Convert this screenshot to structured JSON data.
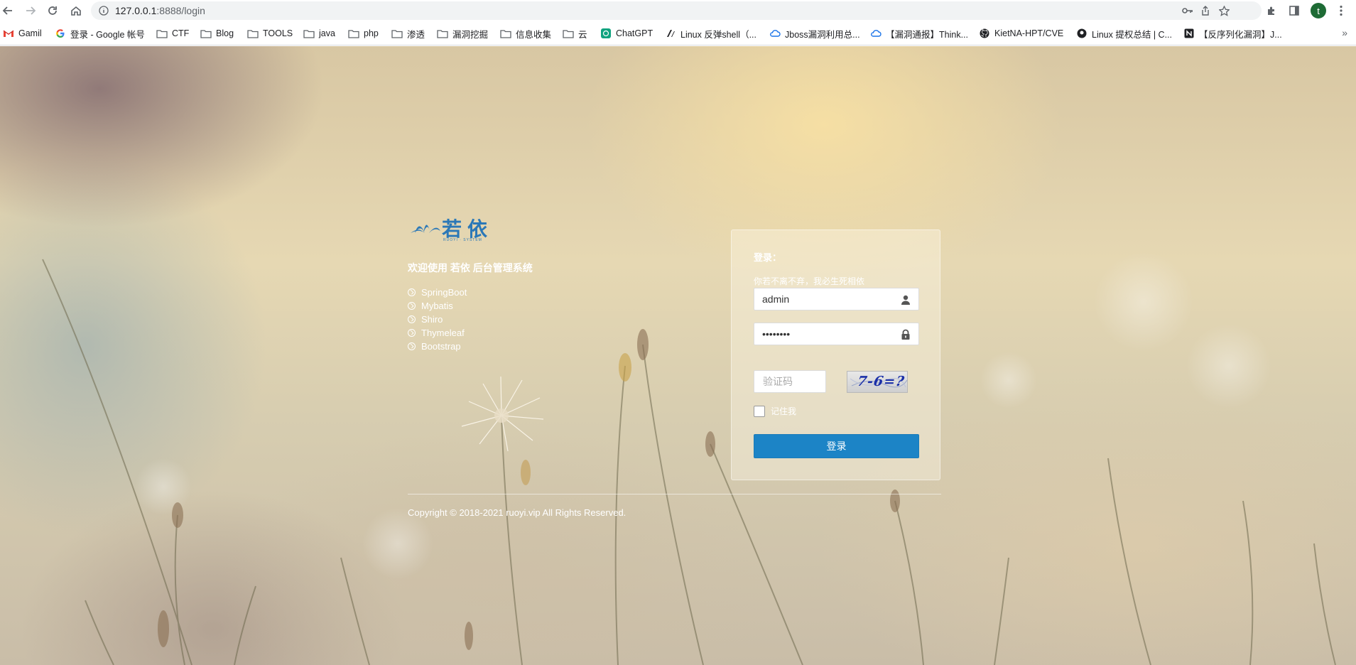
{
  "browser": {
    "url_host": "127.0.0.1",
    "url_path": ":8888/login",
    "profile_initial": "t",
    "bookmarks": [
      {
        "label": "Gamil",
        "icon": "gmail-icon"
      },
      {
        "label": "登录 - Google 帐号",
        "icon": "google-icon"
      },
      {
        "label": "CTF",
        "icon": "folder-icon"
      },
      {
        "label": "Blog",
        "icon": "folder-icon"
      },
      {
        "label": "TOOLS",
        "icon": "folder-icon"
      },
      {
        "label": "java",
        "icon": "folder-icon"
      },
      {
        "label": "php",
        "icon": "folder-icon"
      },
      {
        "label": "渗透",
        "icon": "folder-icon"
      },
      {
        "label": "漏洞挖掘",
        "icon": "folder-icon"
      },
      {
        "label": "信息收集",
        "icon": "folder-icon"
      },
      {
        "label": "云",
        "icon": "folder-icon"
      },
      {
        "label": "ChatGPT",
        "icon": "chatgpt-icon"
      },
      {
        "label": "Linux 反弹shell（...",
        "icon": "zhihu-icon"
      },
      {
        "label": "Jboss漏洞利用总...",
        "icon": "cloud-icon"
      },
      {
        "label": "【漏洞通报】Think...",
        "icon": "cloud-icon"
      },
      {
        "label": "KietNA-HPT/CVE",
        "icon": "github-icon"
      },
      {
        "label": "Linux 提权总结 | C...",
        "icon": "site-icon"
      },
      {
        "label": "【反序列化漏洞】J...",
        "icon": "notion-icon"
      }
    ],
    "more": "»"
  },
  "login": {
    "brand": "若依",
    "brand_sub": "RUOYI · SYSTEM",
    "welcome": "欢迎使用 若依 后台管理系统",
    "features": [
      "SpringBoot",
      "Mybatis",
      "Shiro",
      "Thymeleaf",
      "Bootstrap"
    ],
    "panel_title": "登录：",
    "panel_subtitle": "你若不离不弃，我必生死相依",
    "username_value": "admin",
    "password_value": "admin123",
    "captcha_placeholder": "验证码",
    "captcha_text": "7-6=?",
    "remember_label": "记住我",
    "submit_label": "登录",
    "copyright": "Copyright © 2018-2021 ruoyi.vip All Rights Reserved."
  },
  "colors": {
    "accent": "#1c84c6",
    "logo_blue": "#2b78b7"
  }
}
